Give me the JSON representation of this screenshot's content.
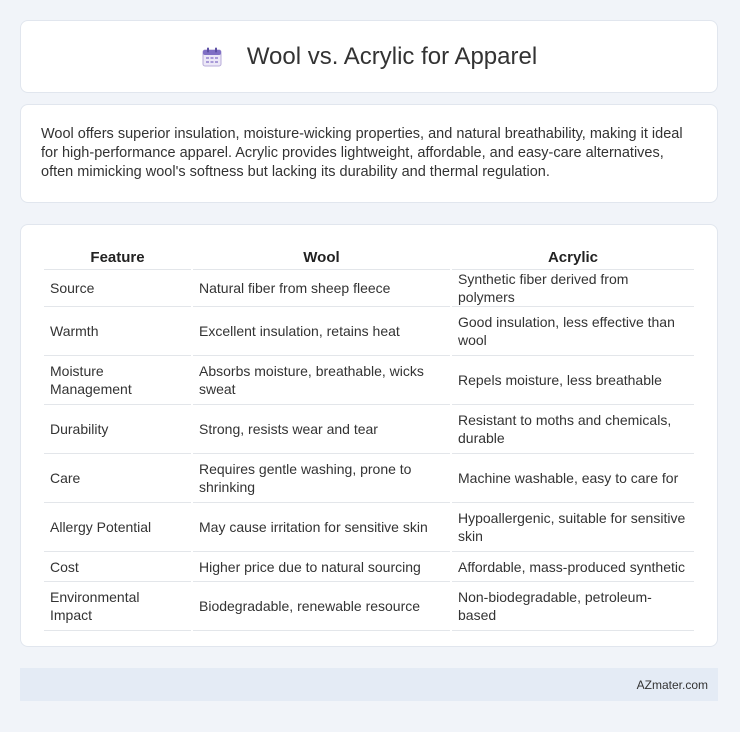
{
  "header": {
    "title": "Wool vs. Acrylic for Apparel",
    "icon": "calendar-icon"
  },
  "intro": {
    "text": "Wool offers superior insulation, moisture-wicking properties, and natural breathability, making it ideal for high-performance apparel. Acrylic provides lightweight, affordable, and easy-care alternatives, often mimicking wool's softness but lacking its durability and thermal regulation."
  },
  "table": {
    "columns": [
      "Feature",
      "Wool",
      "Acrylic"
    ],
    "rows": [
      [
        "Source",
        "Natural fiber from sheep fleece",
        "Synthetic fiber derived from polymers"
      ],
      [
        "Warmth",
        "Excellent insulation, retains heat",
        "Good insulation, less effective than wool"
      ],
      [
        "Moisture Management",
        "Absorbs moisture, breathable, wicks sweat",
        "Repels moisture, less breathable"
      ],
      [
        "Durability",
        "Strong, resists wear and tear",
        "Resistant to moths and chemicals, durable"
      ],
      [
        "Care",
        "Requires gentle washing, prone to shrinking",
        "Machine washable, easy to care for"
      ],
      [
        "Allergy Potential",
        "May cause irritation for sensitive skin",
        "Hypoallergenic, suitable for sensitive skin"
      ],
      [
        "Cost",
        "Higher price due to natural sourcing",
        "Affordable, mass-produced synthetic"
      ],
      [
        "Environmental Impact",
        "Biodegradable, renewable resource",
        "Non-biodegradable, petroleum-based"
      ]
    ]
  },
  "footer": {
    "site": "AZmater.com"
  }
}
